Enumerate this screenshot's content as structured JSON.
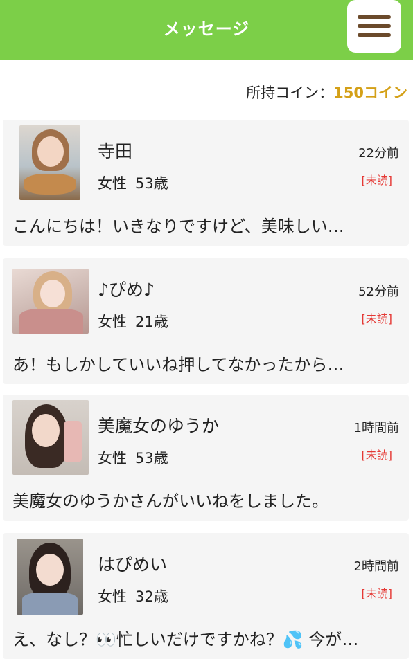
{
  "header": {
    "title": "メッセージ"
  },
  "coins": {
    "label": "所持コイン：",
    "amount": "150コイン"
  },
  "messages": [
    {
      "name": "寺田",
      "gender": "女性",
      "age": "53歳",
      "time": "22分前",
      "status": "[未読]",
      "preview": "こんにちは！いきなりですけど、美味しい…"
    },
    {
      "name": "♪ぴめ♪",
      "gender": "女性",
      "age": "21歳",
      "time": "52分前",
      "status": "[未読]",
      "preview": "あ！もしかしていいね押してなかったから…"
    },
    {
      "name": "美魔女のゆうか",
      "gender": "女性",
      "age": "53歳",
      "time": "1時間前",
      "status": "[未読]",
      "preview": "美魔女のゆうかさんがいいねをしました。"
    },
    {
      "name": "はぴめい",
      "gender": "女性",
      "age": "32歳",
      "time": "2時間前",
      "status": "[未読]",
      "preview": "え、なし？👀忙しいだけですかね？💦 今が…"
    }
  ]
}
